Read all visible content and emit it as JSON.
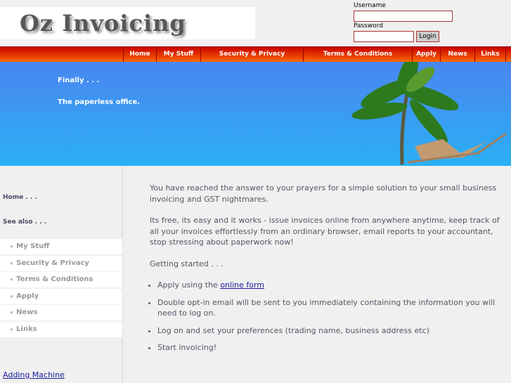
{
  "header": {
    "logo_text": "Oz Invoicing",
    "username_label": "Username",
    "password_label": "Password",
    "username_value": "",
    "password_value": "",
    "login_label": "Login"
  },
  "nav": [
    {
      "label": "Home"
    },
    {
      "label": "My Stuff"
    },
    {
      "label": "Security & Privacy"
    },
    {
      "label": "Terms & Conditions"
    },
    {
      "label": "Apply"
    },
    {
      "label": "News"
    },
    {
      "label": "Links"
    }
  ],
  "hero": {
    "line1": "Finally . . .",
    "line2": "The paperless office."
  },
  "sidebar": {
    "home": "Home . . .",
    "see_also": "See also . . .",
    "bullet": "«",
    "items": [
      {
        "label": "My Stuff"
      },
      {
        "label": "Security & Privacy"
      },
      {
        "label": "Terms & Conditions"
      },
      {
        "label": "Apply"
      },
      {
        "label": "News"
      },
      {
        "label": "Links"
      }
    ],
    "bottom_link": "Adding Machine"
  },
  "main": {
    "p1": "You have reached the answer to your prayers for a simple solution to your small business invoicing and GST nightmares.",
    "p2": "Its free, its easy and it works - issue invoices online from anywhere anytime, keep track of all your invoices effortlessly from an ordinary browser, email reports to your accountant, stop stressing about paperwork now!",
    "p3": "Getting started . . .",
    "step1_prefix": "Apply using the ",
    "step1_link": "online form",
    "step2": "Double opt-in email will be sent to you immediately containing the information you will need to log on.",
    "step3": "Log on and set your preferences (trading name, business address etc)",
    "step4": "Start invoicing!"
  },
  "colors": {
    "nav_top": "#c80000",
    "nav_bottom": "#ff6a00",
    "hero_top": "#4a86f0",
    "hero_bottom": "#2ab0f5",
    "link": "#1a1a99"
  }
}
